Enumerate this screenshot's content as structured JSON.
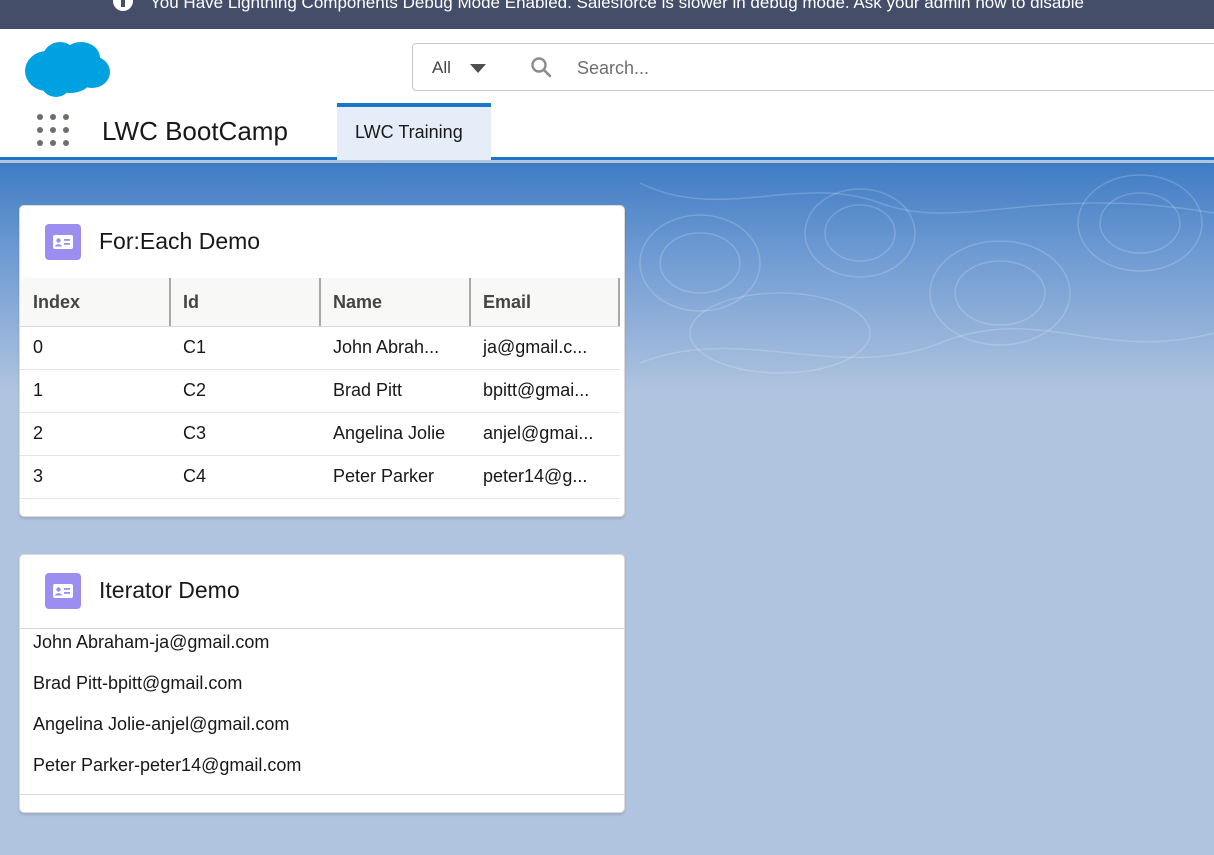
{
  "banner": {
    "text": "You Have Lightning Components Debug Mode Enabled. Salesforce is slower in debug mode. Ask your admin how to disable"
  },
  "header": {
    "search_scope": "All",
    "search_placeholder": "Search..."
  },
  "nav": {
    "app_name": "LWC BootCamp",
    "tabs": [
      {
        "label": "LWC Training"
      }
    ]
  },
  "foreach_card": {
    "title": "For:Each Demo",
    "columns": [
      "Index",
      "Id",
      "Name",
      "Email"
    ],
    "rows": [
      {
        "index": "0",
        "id": "C1",
        "name": "John Abrah...",
        "email": "ja@gmail.c..."
      },
      {
        "index": "1",
        "id": "C2",
        "name": "Brad Pitt",
        "email": "bpitt@gmai..."
      },
      {
        "index": "2",
        "id": "C3",
        "name": "Angelina Jolie",
        "email": "anjel@gmai..."
      },
      {
        "index": "3",
        "id": "C4",
        "name": "Peter Parker",
        "email": "peter14@g..."
      }
    ]
  },
  "iterator_card": {
    "title": "Iterator Demo",
    "items": [
      "John Abraham-ja@gmail.com",
      "Brad Pitt-bpitt@gmail.com",
      "Angelina Jolie-anjel@gmail.com",
      "Peter Parker-peter14@gmail.com"
    ]
  },
  "colors": {
    "banner_bg": "#444e69",
    "brand_blue": "#1b75c9",
    "logo_blue": "#00a1e0",
    "card_icon_purple": "#9b8ef0",
    "page_bg": "#b0c4df"
  },
  "icons": {
    "banner": "info-icon",
    "logo": "salesforce-cloud-logo",
    "scope": "caret-down-icon",
    "search": "search-icon",
    "launcher": "app-launcher-grid-icon",
    "card": "contact-card-icon"
  }
}
